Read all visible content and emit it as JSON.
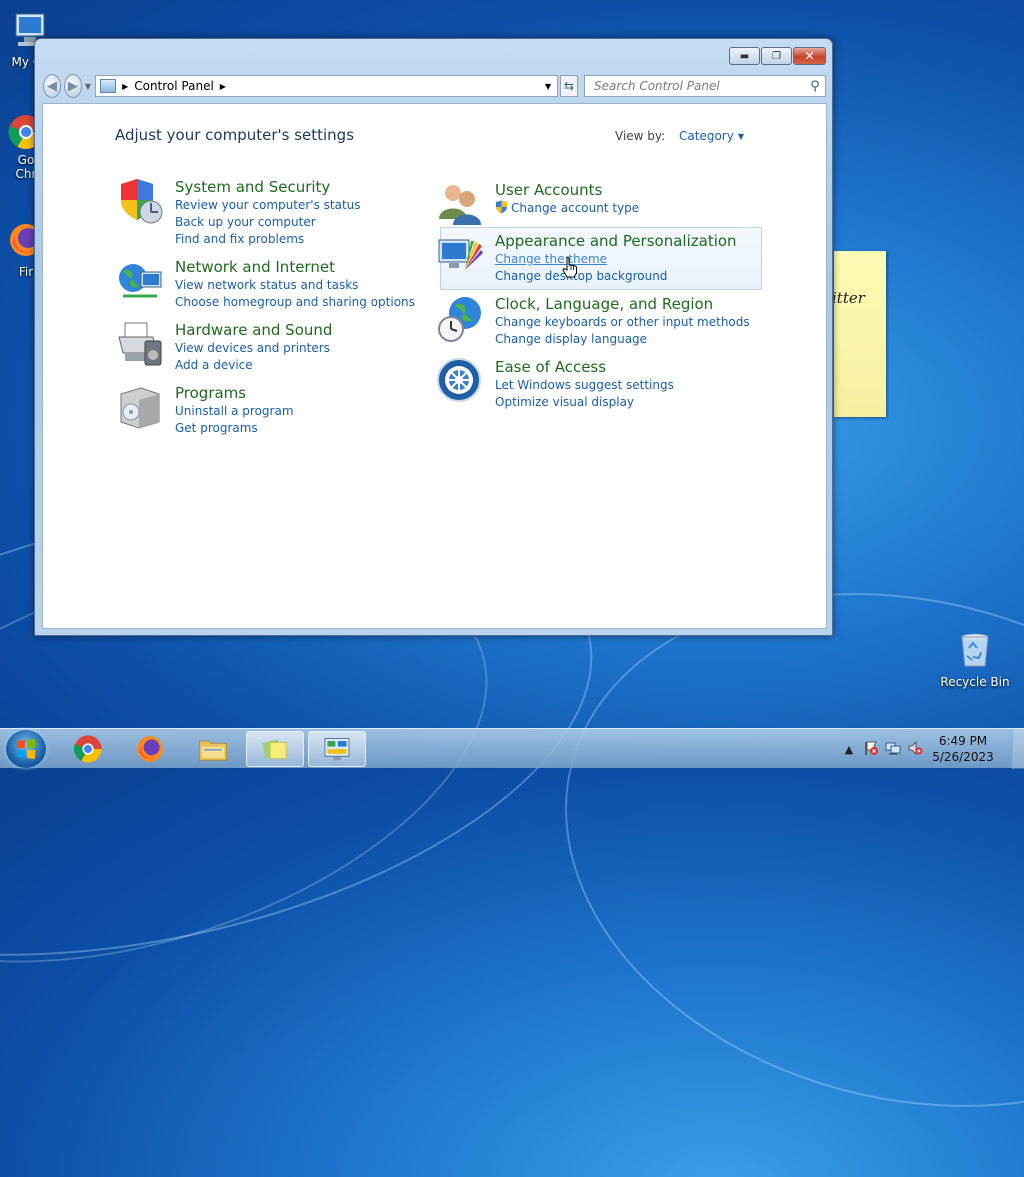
{
  "desktop": {
    "icons": [
      {
        "label": "My Co"
      },
      {
        "label": "Go"
      },
      {
        "label": "Chr"
      },
      {
        "label": "Fir"
      },
      {
        "label": "Recycle Bin"
      }
    ],
    "sticky_note_text": "itter"
  },
  "window": {
    "address": {
      "location": "Control Panel"
    },
    "search": {
      "placeholder": "Search Control Panel"
    },
    "page_title": "Adjust your computer's settings",
    "view_by": {
      "label": "View by:",
      "value": "Category"
    },
    "categories_left": [
      {
        "title": "System and Security",
        "links": [
          "Review your computer's status",
          "Back up your computer",
          "Find and fix problems"
        ]
      },
      {
        "title": "Network and Internet",
        "links": [
          "View network status and tasks",
          "Choose homegroup and sharing options"
        ]
      },
      {
        "title": "Hardware and Sound",
        "links": [
          "View devices and printers",
          "Add a device"
        ]
      },
      {
        "title": "Programs",
        "links": [
          "Uninstall a program",
          "Get programs"
        ]
      }
    ],
    "categories_right": [
      {
        "title": "User Accounts",
        "links": [
          "Change account type"
        ]
      },
      {
        "title": "Appearance and Personalization",
        "links": [
          "Change the theme",
          "Change desktop background"
        ]
      },
      {
        "title": "Clock, Language, and Region",
        "links": [
          "Change keyboards or other input methods",
          "Change display language"
        ]
      },
      {
        "title": "Ease of Access",
        "links": [
          "Let Windows suggest settings",
          "Optimize visual display"
        ]
      }
    ]
  },
  "taskbar": {
    "clock": {
      "time": "6:49 PM",
      "date": "5/26/2023"
    },
    "tray_expand": "▲"
  },
  "colors": {
    "link": "#1a5ea9",
    "category": "#1e6b1e",
    "title": "#1e395b"
  }
}
